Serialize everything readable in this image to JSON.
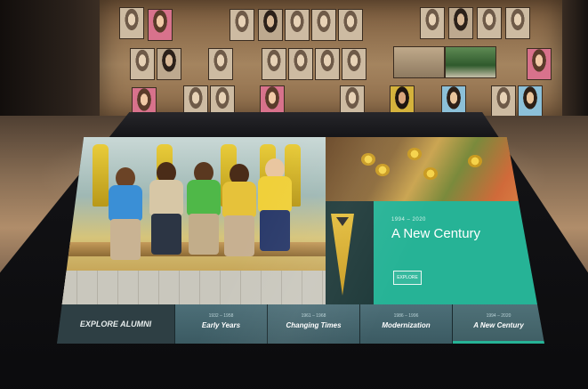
{
  "screen": {
    "era_panel": {
      "years": "1994 – 2020",
      "title": "A New Century",
      "explore_label": "EXPLORE"
    },
    "nav": {
      "explore_label": "EXPLORE ALUMNI",
      "items": [
        {
          "years": "1932 – 1958",
          "label": "Early Years"
        },
        {
          "years": "1961 – 1968",
          "label": "Changing Times"
        },
        {
          "years": "1986 – 1996",
          "label": "Modernization"
        },
        {
          "years": "1994 – 2020",
          "label": "A New Century",
          "active": true
        }
      ]
    },
    "accent_color": "#26b396",
    "nav_color": "#3b5a62"
  }
}
